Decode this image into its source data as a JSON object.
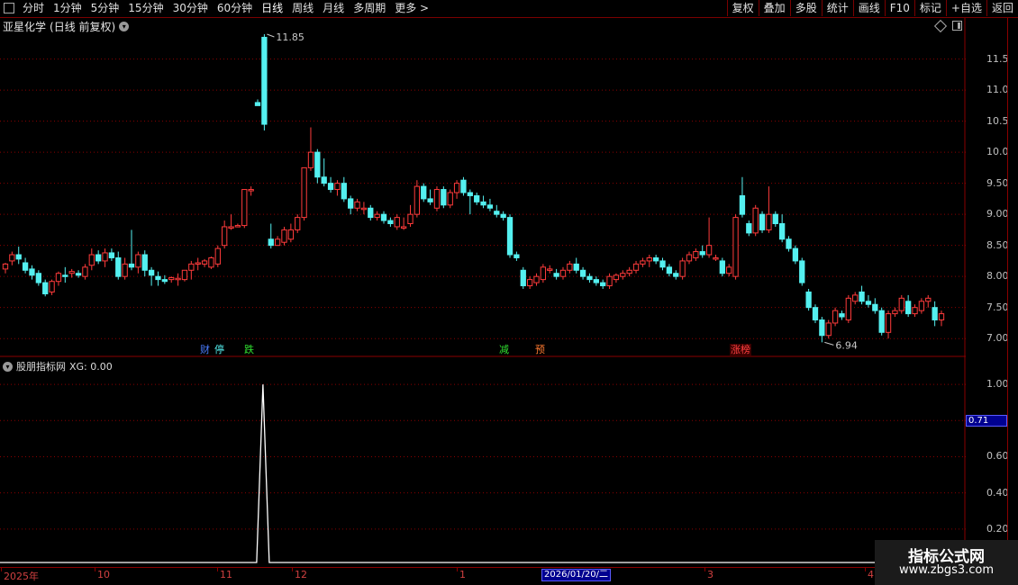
{
  "toolbar": {
    "periods": [
      {
        "label": "分时",
        "active": false
      },
      {
        "label": "1分钟",
        "active": false
      },
      {
        "label": "5分钟",
        "active": false
      },
      {
        "label": "15分钟",
        "active": false
      },
      {
        "label": "30分钟",
        "active": false
      },
      {
        "label": "60分钟",
        "active": false
      },
      {
        "label": "日线",
        "active": true
      },
      {
        "label": "周线",
        "active": false
      },
      {
        "label": "月线",
        "active": false
      },
      {
        "label": "多周期",
        "active": false
      },
      {
        "label": "更多 >",
        "active": false
      }
    ],
    "right_buttons": [
      "复权",
      "叠加",
      "多股",
      "统计",
      "画线",
      "F10",
      "标记",
      "+自选",
      "返回"
    ]
  },
  "title": {
    "stock": "亚星化学",
    "mode": "(日线 前复权)"
  },
  "colors": {
    "up": "#ff3b3b",
    "down": "#54f0f0",
    "grid": "#8a0000",
    "axis_text": "#c0c0c0"
  },
  "price_axis": {
    "labels": [
      "11.50",
      "11.00",
      "10.50",
      "10.00",
      "9.50",
      "9.00",
      "8.50",
      "8.00",
      "7.50",
      "7.00"
    ]
  },
  "annotations": {
    "high": "11.85",
    "low": "6.94"
  },
  "events": [
    {
      "text": "财",
      "color": "#4a7dff",
      "bg": "#000"
    },
    {
      "text": "停",
      "color": "#54f0f0",
      "bg": "#000"
    },
    {
      "text": "跌",
      "color": "#30e030",
      "bg": "#000"
    },
    {
      "text": "减",
      "color": "#30e030",
      "bg": "#000"
    },
    {
      "text": "预",
      "color": "#ff7a30",
      "bg": "#000"
    },
    {
      "text": "涨榜",
      "color": "#ff4040",
      "bg": "#000"
    }
  ],
  "indicator": {
    "name": "股朋指标网",
    "label": "XG: 0.00",
    "axis_labels": [
      "1.00",
      "0.80",
      "0.60",
      "0.40",
      "0.20"
    ],
    "highlight_value": "0.71"
  },
  "date_axis": {
    "labels": [
      "2025年",
      "10",
      "11",
      "12",
      "1",
      "3",
      "4"
    ],
    "highlight": "2026/01/20/二"
  },
  "watermark": {
    "title": "指标公式网",
    "url": "www.zbgs3.com"
  },
  "chart_data": {
    "type": "candlestick",
    "title": "亚星化学",
    "ylim": [
      6.8,
      11.9
    ],
    "candles": [
      [
        8.12,
        8.22,
        8.05,
        8.2
      ],
      [
        8.25,
        8.4,
        8.18,
        8.35
      ],
      [
        8.35,
        8.48,
        8.2,
        8.28
      ],
      [
        8.22,
        8.3,
        8.05,
        8.1
      ],
      [
        8.12,
        8.18,
        7.95,
        8.02
      ],
      [
        8.05,
        8.1,
        7.85,
        7.9
      ],
      [
        7.9,
        7.95,
        7.68,
        7.72
      ],
      [
        7.75,
        7.95,
        7.7,
        7.92
      ],
      [
        7.92,
        8.08,
        7.85,
        8.05
      ],
      [
        8.02,
        8.15,
        7.9,
        8.0
      ],
      [
        8.05,
        8.12,
        7.98,
        8.08
      ],
      [
        8.05,
        8.1,
        7.98,
        8.02
      ],
      [
        8.0,
        8.2,
        7.95,
        8.15
      ],
      [
        8.18,
        8.45,
        8.1,
        8.35
      ],
      [
        8.35,
        8.42,
        8.2,
        8.25
      ],
      [
        8.25,
        8.45,
        8.15,
        8.38
      ],
      [
        8.38,
        8.45,
        8.25,
        8.3
      ],
      [
        8.3,
        8.4,
        7.95,
        8.0
      ],
      [
        8.0,
        8.3,
        7.95,
        8.2
      ],
      [
        8.2,
        8.75,
        8.1,
        8.15
      ],
      [
        8.15,
        8.4,
        8.05,
        8.35
      ],
      [
        8.35,
        8.42,
        8.0,
        8.1
      ],
      [
        8.1,
        8.15,
        7.85,
        8.02
      ],
      [
        8.0,
        8.08,
        7.85,
        7.95
      ],
      [
        7.95,
        8.02,
        7.88,
        7.92
      ],
      [
        7.95,
        8.0,
        7.9,
        7.98
      ],
      [
        7.95,
        8.05,
        7.85,
        7.97
      ],
      [
        7.95,
        8.1,
        7.92,
        8.1
      ],
      [
        8.1,
        8.25,
        7.95,
        8.2
      ],
      [
        8.2,
        8.3,
        8.1,
        8.22
      ],
      [
        8.2,
        8.28,
        8.15,
        8.25
      ],
      [
        8.15,
        8.32,
        8.12,
        8.3
      ],
      [
        8.2,
        8.5,
        8.15,
        8.45
      ],
      [
        8.5,
        8.9,
        8.45,
        8.8
      ],
      [
        8.8,
        9.0,
        8.75,
        8.8
      ],
      [
        8.82,
        8.85,
        8.8,
        8.82
      ],
      [
        8.82,
        9.4,
        8.78,
        9.4
      ],
      [
        9.4,
        9.45,
        9.3,
        9.4
      ],
      [
        10.8,
        10.85,
        10.75,
        10.75
      ],
      [
        11.85,
        11.9,
        10.35,
        10.45
      ],
      [
        8.6,
        8.85,
        8.45,
        8.5
      ],
      [
        8.5,
        8.65,
        8.5,
        8.6
      ],
      [
        8.55,
        8.8,
        8.5,
        8.75
      ],
      [
        8.6,
        8.85,
        8.55,
        8.75
      ],
      [
        8.75,
        9.0,
        8.7,
        8.95
      ],
      [
        8.95,
        9.75,
        8.9,
        9.75
      ],
      [
        9.75,
        10.4,
        9.7,
        10.0
      ],
      [
        10.0,
        10.05,
        9.5,
        9.6
      ],
      [
        9.6,
        9.9,
        9.45,
        9.5
      ],
      [
        9.5,
        9.6,
        9.35,
        9.4
      ],
      [
        9.4,
        9.55,
        9.3,
        9.5
      ],
      [
        9.5,
        9.6,
        9.2,
        9.25
      ],
      [
        9.25,
        9.3,
        9.0,
        9.1
      ],
      [
        9.1,
        9.25,
        9.05,
        9.2
      ],
      [
        9.1,
        9.2,
        9.0,
        9.1
      ],
      [
        9.1,
        9.15,
        8.9,
        8.95
      ],
      [
        8.95,
        9.05,
        8.9,
        9.0
      ],
      [
        9.0,
        9.05,
        8.85,
        8.9
      ],
      [
        8.9,
        8.95,
        8.8,
        8.85
      ],
      [
        8.8,
        9.0,
        8.75,
        8.95
      ],
      [
        8.8,
        8.95,
        8.75,
        8.8
      ],
      [
        8.85,
        9.15,
        8.8,
        9.0
      ],
      [
        9.0,
        9.55,
        8.95,
        9.45
      ],
      [
        9.45,
        9.5,
        9.2,
        9.25
      ],
      [
        9.25,
        9.4,
        9.15,
        9.2
      ],
      [
        9.1,
        9.45,
        9.05,
        9.4
      ],
      [
        9.4,
        9.45,
        9.1,
        9.15
      ],
      [
        9.15,
        9.4,
        9.1,
        9.35
      ],
      [
        9.35,
        9.55,
        9.25,
        9.5
      ],
      [
        9.55,
        9.6,
        9.3,
        9.35
      ],
      [
        9.35,
        9.4,
        9.0,
        9.3
      ],
      [
        9.3,
        9.35,
        9.15,
        9.2
      ],
      [
        9.2,
        9.3,
        9.1,
        9.15
      ],
      [
        9.15,
        9.25,
        9.05,
        9.1
      ],
      [
        9.05,
        9.15,
        8.95,
        9.0
      ],
      [
        9.0,
        9.05,
        8.9,
        8.95
      ],
      [
        8.95,
        9.0,
        8.3,
        8.35
      ],
      [
        8.35,
        8.4,
        8.25,
        8.3
      ],
      [
        8.1,
        8.15,
        7.8,
        7.85
      ],
      [
        7.85,
        8.0,
        7.8,
        7.95
      ],
      [
        7.9,
        8.05,
        7.85,
        8.0
      ],
      [
        7.95,
        8.2,
        7.9,
        8.15
      ],
      [
        8.1,
        8.18,
        8.05,
        8.12
      ],
      [
        8.05,
        8.12,
        7.95,
        8.0
      ],
      [
        8.0,
        8.15,
        7.95,
        8.1
      ],
      [
        8.1,
        8.25,
        8.05,
        8.2
      ],
      [
        8.2,
        8.3,
        8.05,
        8.1
      ],
      [
        8.1,
        8.15,
        7.95,
        8.0
      ],
      [
        8.0,
        8.05,
        7.9,
        7.95
      ],
      [
        7.95,
        8.0,
        7.85,
        7.9
      ],
      [
        7.9,
        7.95,
        7.8,
        7.85
      ],
      [
        7.85,
        8.05,
        7.8,
        8.0
      ],
      [
        7.95,
        8.05,
        7.9,
        8.02
      ],
      [
        8.0,
        8.1,
        7.95,
        8.05
      ],
      [
        8.05,
        8.15,
        8.0,
        8.1
      ],
      [
        8.1,
        8.25,
        8.05,
        8.2
      ],
      [
        8.2,
        8.3,
        8.15,
        8.25
      ],
      [
        8.25,
        8.35,
        8.15,
        8.3
      ],
      [
        8.3,
        8.35,
        8.2,
        8.25
      ],
      [
        8.25,
        8.3,
        8.1,
        8.15
      ],
      [
        8.15,
        8.2,
        8.0,
        8.05
      ],
      [
        8.05,
        8.1,
        7.95,
        8.0
      ],
      [
        8.0,
        8.3,
        7.95,
        8.25
      ],
      [
        8.25,
        8.4,
        8.2,
        8.35
      ],
      [
        8.3,
        8.45,
        8.25,
        8.4
      ],
      [
        8.4,
        8.5,
        8.3,
        8.35
      ],
      [
        8.35,
        8.95,
        8.3,
        8.5
      ],
      [
        8.3,
        8.35,
        8.25,
        8.3
      ],
      [
        8.25,
        8.3,
        8.0,
        8.05
      ],
      [
        8.05,
        8.2,
        8.0,
        8.15
      ],
      [
        8.0,
        9.0,
        7.95,
        8.95
      ],
      [
        9.3,
        9.6,
        8.95,
        9.0
      ],
      [
        8.85,
        8.9,
        8.65,
        8.7
      ],
      [
        8.7,
        9.15,
        8.65,
        9.1
      ],
      [
        9.0,
        9.05,
        8.7,
        8.75
      ],
      [
        8.75,
        9.45,
        8.7,
        9.0
      ],
      [
        9.0,
        9.05,
        8.8,
        8.85
      ],
      [
        8.85,
        9.0,
        8.55,
        8.6
      ],
      [
        8.6,
        8.65,
        8.4,
        8.45
      ],
      [
        8.45,
        8.5,
        8.2,
        8.25
      ],
      [
        8.25,
        8.3,
        7.85,
        7.9
      ],
      [
        7.75,
        7.8,
        7.45,
        7.5
      ],
      [
        7.5,
        7.55,
        7.25,
        7.3
      ],
      [
        7.3,
        7.35,
        6.94,
        7.05
      ],
      [
        7.05,
        7.3,
        7.0,
        7.25
      ],
      [
        7.25,
        7.5,
        7.2,
        7.45
      ],
      [
        7.4,
        7.45,
        7.3,
        7.35
      ],
      [
        7.3,
        7.7,
        7.25,
        7.65
      ],
      [
        7.6,
        7.75,
        7.55,
        7.7
      ],
      [
        7.75,
        7.85,
        7.55,
        7.6
      ],
      [
        7.6,
        7.7,
        7.5,
        7.55
      ],
      [
        7.55,
        7.65,
        7.4,
        7.45
      ],
      [
        7.45,
        7.5,
        7.05,
        7.1
      ],
      [
        7.1,
        7.45,
        7.0,
        7.4
      ],
      [
        7.4,
        7.5,
        7.35,
        7.45
      ],
      [
        7.45,
        7.7,
        7.4,
        7.65
      ],
      [
        7.6,
        7.7,
        7.35,
        7.4
      ],
      [
        7.4,
        7.55,
        7.35,
        7.5
      ],
      [
        7.45,
        7.65,
        7.4,
        7.6
      ],
      [
        7.6,
        7.7,
        7.5,
        7.65
      ],
      [
        7.5,
        7.6,
        7.2,
        7.3
      ],
      [
        7.3,
        7.45,
        7.2,
        7.4
      ]
    ],
    "indicator_series": {
      "name": "XG",
      "ylim": [
        0,
        1.0
      ],
      "spike_index": 39,
      "spike_value": 1.0
    }
  }
}
